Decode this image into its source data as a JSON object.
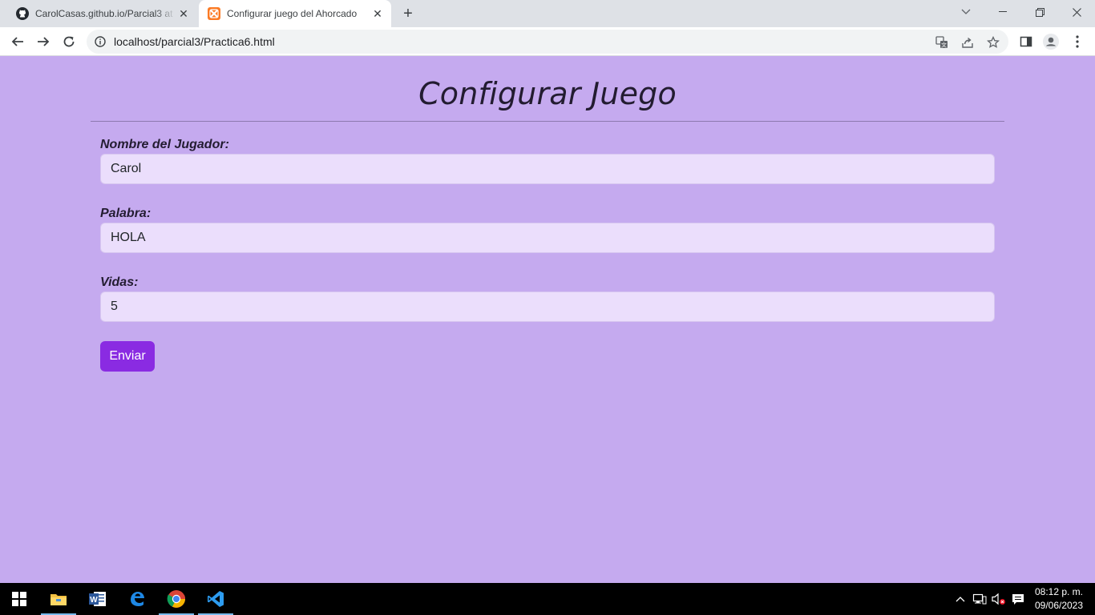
{
  "browser": {
    "tabs": [
      {
        "title": "CarolCasas.github.io/Parcial3 at main",
        "icon": "github-icon",
        "active": false
      },
      {
        "title": "Configurar juego del Ahorcado",
        "icon": "xampp-icon",
        "active": true
      }
    ],
    "address": "localhost/parcial3/Practica6.html"
  },
  "page": {
    "heading": "Configurar Juego",
    "fields": [
      {
        "label": "Nombre del Jugador:",
        "value": "Carol"
      },
      {
        "label": "Palabra:",
        "value": "HOLA"
      },
      {
        "label": "Vidas:",
        "value": "5"
      }
    ],
    "submit_label": "Enviar"
  },
  "taskbar": {
    "apps": [
      "file-explorer-icon",
      "word-icon",
      "edge-icon",
      "chrome-icon",
      "vscode-icon"
    ],
    "time": "08:12 p. m.",
    "date": "09/06/2023"
  },
  "colors": {
    "page_background": "#c5aaef",
    "input_background": "#ebdefc",
    "button_background": "#8a2be2",
    "heading_text": "#231c31"
  }
}
